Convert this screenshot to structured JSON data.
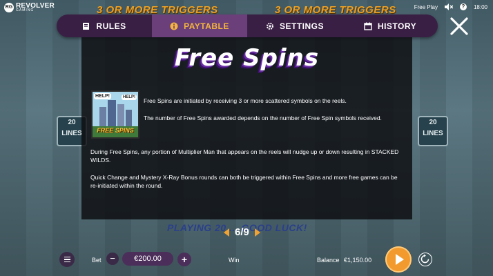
{
  "brand": {
    "logo_badge": "RG",
    "name": "REVOLVER",
    "sub": "GAMING"
  },
  "status": {
    "mode": "Free Play",
    "time": "18:00"
  },
  "background": {
    "banner_left": "3 OR MORE TRIGGERS",
    "banner_right": "3 OR MORE TRIGGERS",
    "lines_left": "20 LINES",
    "lines_right": "20 LINES",
    "bottom_text": "PLAYING 20 ... GOOD LUCK!"
  },
  "tabs": [
    {
      "label": "RULES",
      "icon": "book-icon"
    },
    {
      "label": "PAYTABLE",
      "icon": "info-icon",
      "active": true
    },
    {
      "label": "SETTINGS",
      "icon": "gear-icon"
    },
    {
      "label": "HISTORY",
      "icon": "calendar-icon"
    }
  ],
  "panel": {
    "title": "Free Spins",
    "symbol_label": "FREE SPINS",
    "symbol_help": "HELP!",
    "paragraphs": [
      "Free Spins are initiated by receiving 3 or more scattered symbols on the reels.",
      "The number of Free Spins awarded depends on the number of Free Spin symbols received.",
      "During Free Spins, any portion of Multiplier Man that appears on the reels will nudge up or down resulting in STACKED WILDS.",
      "Quick Change and Mystery X-Ray Bonus rounds can both be triggered within Free Spins and more free games can be re-initiated within the round."
    ]
  },
  "pager": {
    "text": "6/9"
  },
  "bottom": {
    "bet_label": "Bet",
    "bet_value": "€200.00",
    "win_label": "Win",
    "balance_label": "Balance",
    "balance_value": "€1,150.00"
  },
  "colors": {
    "accent": "#f3b540",
    "tab_bar": "#3a1f45",
    "active_tab": "#6b3f79",
    "spin": "#f29a2e"
  }
}
